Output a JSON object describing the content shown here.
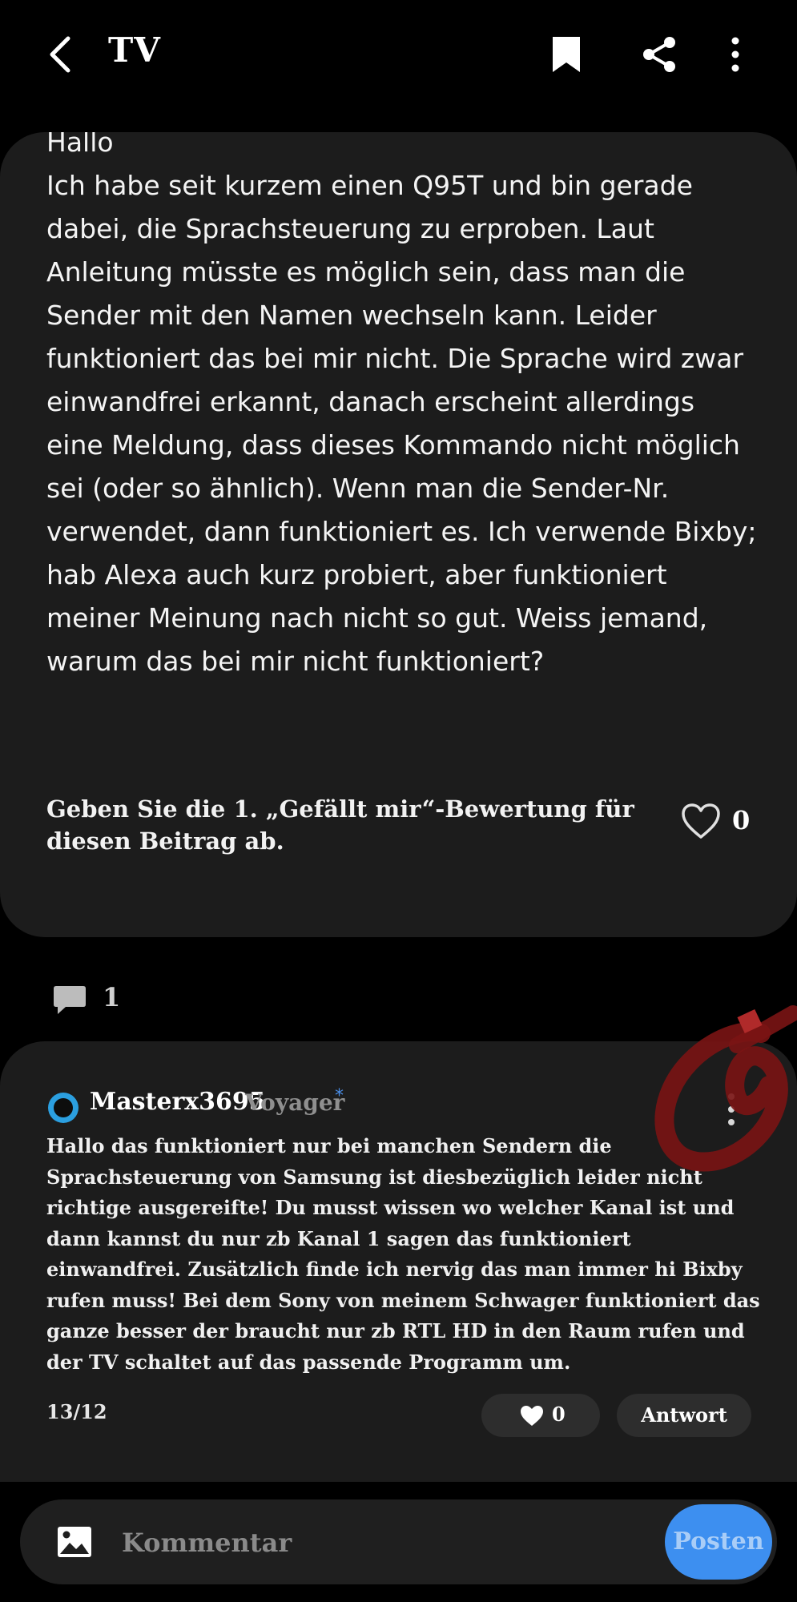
{
  "header": {
    "title": "TV"
  },
  "post": {
    "body": "Hallo\nIch habe seit kurzem einen Q95T und bin gerade dabei, die Sprachsteuerung zu erproben. Laut Anleitung müsste es möglich sein, dass man die Sender mit den Namen wechseln kann. Leider funktioniert das bei mir nicht. Die Sprache wird zwar einwandfrei erkannt, danach erscheint allerdings eine Meldung, dass dieses Kommando nicht möglich sei (oder so ähnlich). Wenn man die Sender-Nr. verwendet, dann funktioniert es. Ich verwende Bixby; hab Alexa auch kurz probiert, aber funktioniert meiner Meinung nach nicht so gut. Weiss jemand, warum das bei mir nicht funktioniert?",
    "like_prompt": "Geben Sie die 1. „Gefällt mir“-Bewertung für diesen Beitrag ab.",
    "like_count": "0",
    "comment_count": "1"
  },
  "reply": {
    "author": "Masterx3695",
    "rank": "Voyager",
    "rank_star": "*",
    "text": "Hallo das funktioniert nur bei manchen Sendern die Sprachsteuerung von Samsung ist diesbezüglich leider nicht richtige ausgereifte! Du musst wissen wo welcher Kanal ist und dann kannst du nur zb Kanal 1 sagen das funktioniert einwandfrei. Zusätzlich finde ich nervig das man immer hi Bixby rufen muss! Bei dem Sony von meinem Schwager funktioniert das ganze besser der braucht nur zb RTL HD in den Raum rufen und der TV schaltet auf das passende Programm um.",
    "date": "13/12",
    "like_count": "0",
    "answer_label": "Antwort"
  },
  "composer": {
    "placeholder": "Kommentar",
    "post_label": "Posten"
  },
  "icons": {
    "back": "chevron-left-icon",
    "bookmark": "bookmark-icon",
    "share": "share-icon",
    "more": "more-vertical-icon",
    "heart": "heart-icon",
    "comment": "comment-bubble-icon",
    "image": "image-icon"
  },
  "colors": {
    "background": "#000000",
    "card": "#1c1c1c",
    "accent": "#3d8ff0",
    "annotation": "#7a1414"
  }
}
